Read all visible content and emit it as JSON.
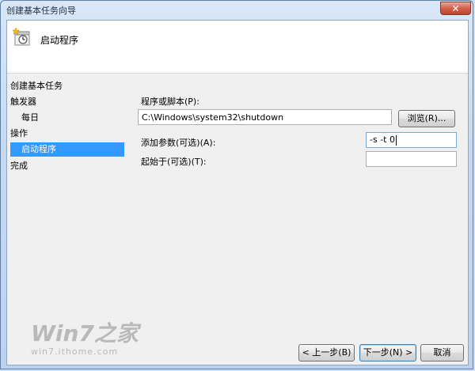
{
  "window": {
    "title": "创建基本任务向导",
    "close_label": "✕"
  },
  "header": {
    "title": "启动程序",
    "icon": "task-scheduler-icon"
  },
  "nav": {
    "title": "创建基本任务",
    "items": [
      {
        "label": "触发器",
        "level": 0,
        "selected": false
      },
      {
        "label": "每日",
        "level": 1,
        "selected": false
      },
      {
        "label": "操作",
        "level": 0,
        "selected": false
      },
      {
        "label": "启动程序",
        "level": 1,
        "selected": true
      },
      {
        "label": "完成",
        "level": 0,
        "selected": false
      }
    ]
  },
  "form": {
    "program_label": "程序或脚本(P):",
    "program_value": "C:\\Windows\\system32\\shutdown",
    "browse_label": "浏览(R)...",
    "args_label": "添加参数(可选)(A):",
    "args_value": "-s -t 0",
    "startin_label": "起始于(可选)(T):",
    "startin_value": ""
  },
  "buttons": {
    "back": "< 上一步(B)",
    "next": "下一步(N) >",
    "cancel": "取消"
  },
  "watermark": {
    "main": "Win7之家",
    "sub": "win7.ithome.com"
  },
  "colors": {
    "selection": "#3399ff",
    "accent_border": "#3c7fb1"
  }
}
